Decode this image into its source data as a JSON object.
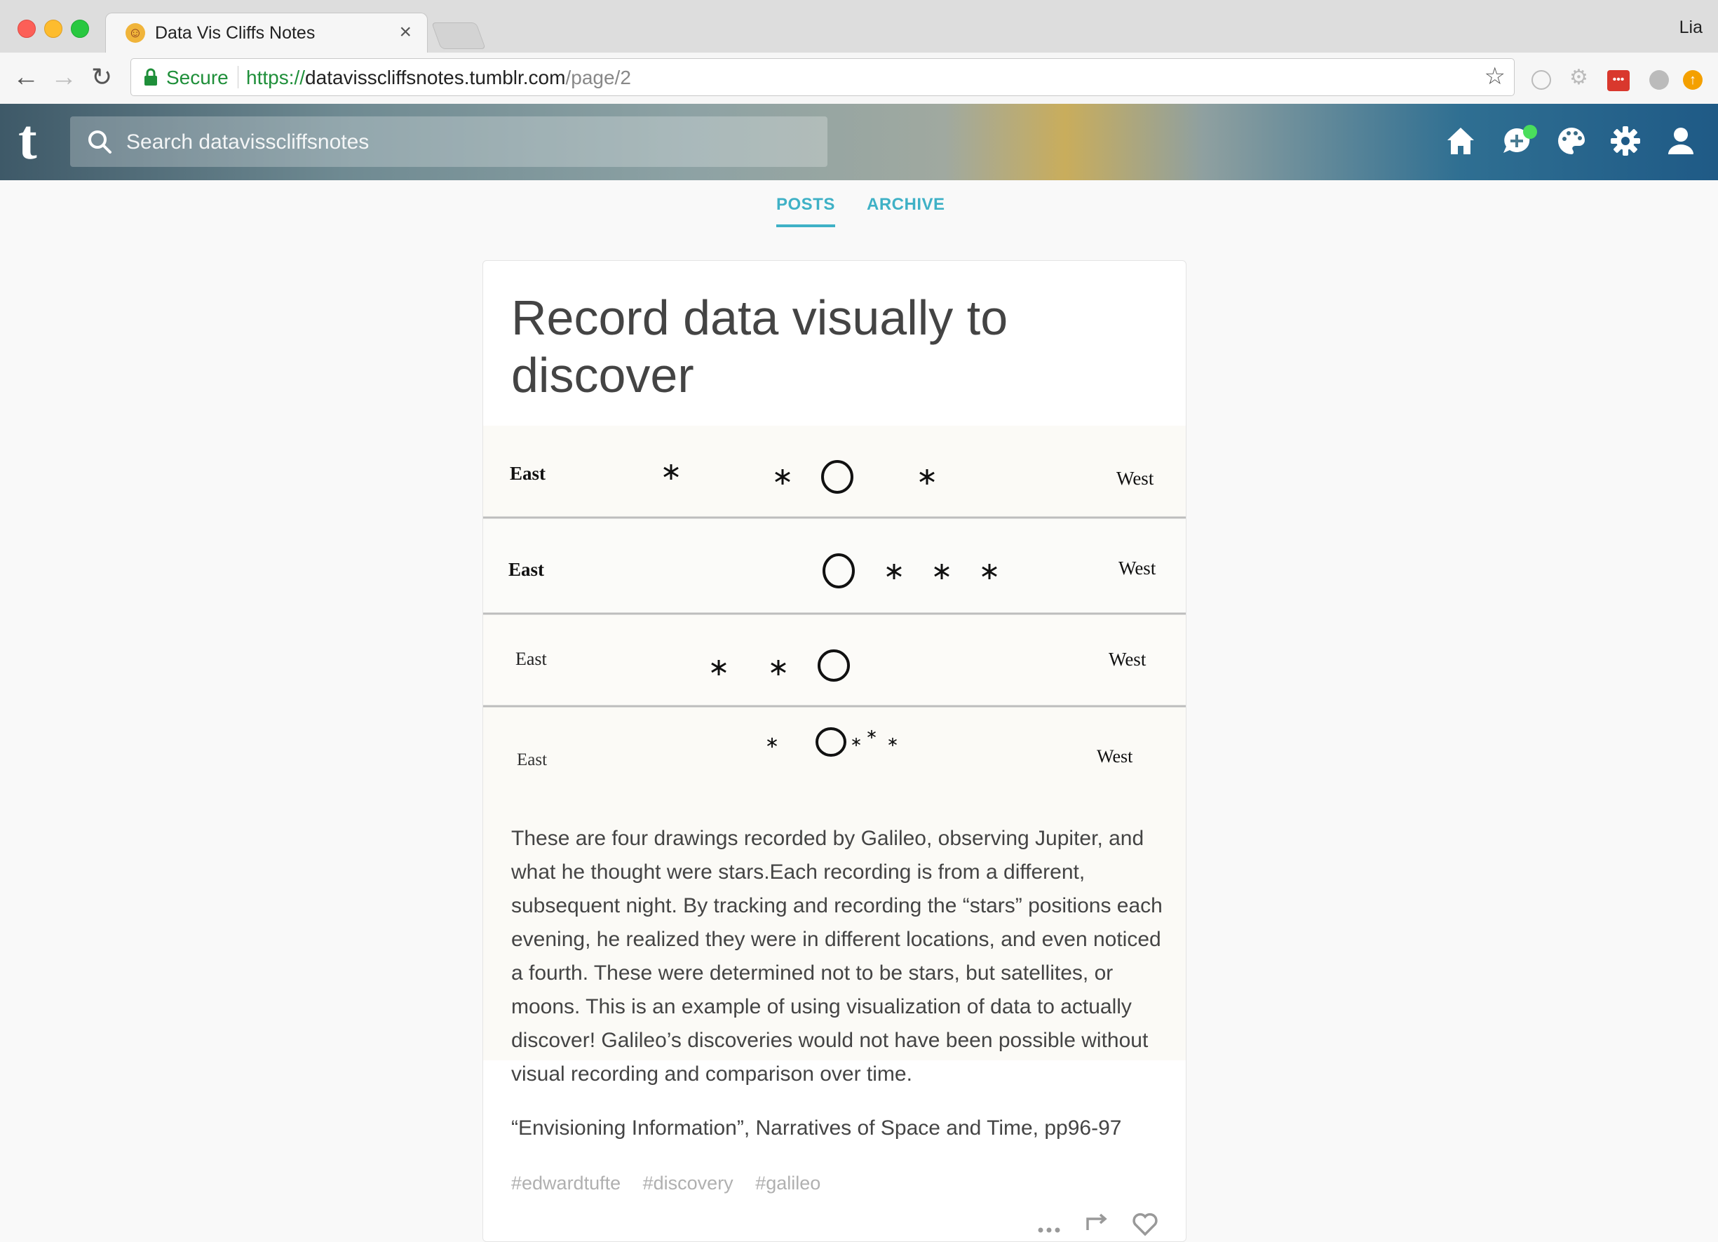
{
  "browser": {
    "tab_title": "Data Vis Cliffs Notes",
    "profile_name": "Lia",
    "secure_label": "Secure",
    "url_scheme": "https://",
    "url_host": "datavisscliffsnotes.tumblr.com",
    "url_path": "/page/2"
  },
  "tumblr": {
    "logo": "t",
    "search_placeholder": "Search datavisscliffsnotes"
  },
  "blog_nav": {
    "posts": "POSTS",
    "archive": "ARCHIVE"
  },
  "post": {
    "title": "Record data visually to discover",
    "drawing_labels": {
      "east": "East",
      "west": "West"
    },
    "body": "These are four drawings recorded by Galileo, observing Jupiter, and what he thought were stars.Each recording is from a different, subsequent night. By tracking and recording the “stars” positions each evening, he realized they were in different locations, and even noticed a fourth. These were determined not to be stars, but satellites, or moons. This is an example of using visualization of data to actually discover! Galileo’s discoveries would not have been possible without visual recording and comparison over time.",
    "citation": "“Envisioning Information”, Narratives of Space and Time, pp96-97",
    "tags": [
      "#edwardtufte",
      "#discovery",
      "#galileo"
    ]
  },
  "colors": {
    "accent": "#3fb1c6",
    "secure_green": "#1f8f3a",
    "text": "#444444"
  }
}
